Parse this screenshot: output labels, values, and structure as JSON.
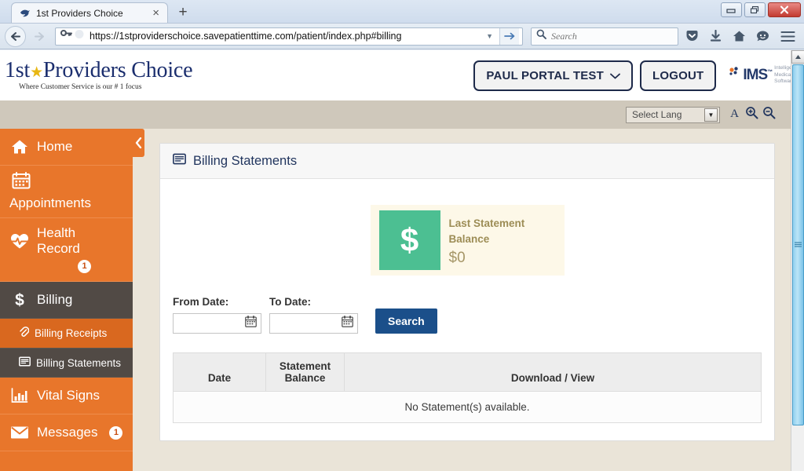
{
  "browser": {
    "tab": {
      "title": "1st Providers Choice",
      "favicon_icon": "bird-favicon",
      "close_icon": "close-icon"
    },
    "new_tab_label": "+",
    "window_controls": {
      "minimize_icon": "minimize-icon",
      "restore_icon": "restore-icon",
      "close_icon": "window-close-icon"
    },
    "nav": {
      "back_icon": "back-arrow-icon",
      "forward_icon": "forward-arrow-icon",
      "url": "https://1stproviderschoice.savepatienttime.com/patient/index.php#billing",
      "identity_icon": "key-icon",
      "reader_icon": "reader-mode-icon",
      "dropdown_icon": "chevron-down-icon",
      "go_icon": "go-arrow-icon",
      "search_placeholder": "Search",
      "search_icon": "search-icon",
      "pocket_icon": "pocket-icon",
      "downloads_icon": "downloads-icon",
      "home_icon": "home-icon",
      "sync_icon": "chat-icon",
      "menu_icon": "hamburger-menu-icon"
    }
  },
  "site": {
    "logo": {
      "prefix": "1st",
      "star": "★",
      "main": "Providers Choice",
      "tagline": "Where Customer Service is our # 1 focus"
    },
    "user_button": {
      "label": "PAUL PORTAL TEST",
      "caret_icon": "chevron-down-icon"
    },
    "logout_button": "LOGOUT",
    "ims": {
      "mark": "IMS",
      "tm": "™",
      "tagline_line1": "Intelligent",
      "tagline_line2": "Medical",
      "tagline_line3": "Software",
      "dots_icon": "ims-dots-icon"
    },
    "lang_bar": {
      "select_value": "Select Lang",
      "select_arrow_icon": "dropdown-arrow-icon",
      "font_icon": "font-size-icon",
      "zoom_in_icon": "zoom-in-icon",
      "zoom_out_icon": "zoom-out-icon"
    }
  },
  "sidebar": {
    "collapse_icon": "chevron-left-icon",
    "items": [
      {
        "label": "Home",
        "icon": "home-icon",
        "badge": null,
        "state": "normal"
      },
      {
        "label": "Appointments",
        "icon": "calendar-icon",
        "badge": null,
        "state": "normal"
      },
      {
        "label": "Health Record",
        "icon": "heart-pulse-icon",
        "badge": "1",
        "state": "normal"
      },
      {
        "label": "Billing",
        "icon": "dollar-icon",
        "badge": null,
        "state": "active"
      },
      {
        "label": "Vital Signs",
        "icon": "bar-chart-icon",
        "badge": null,
        "state": "normal"
      },
      {
        "label": "Messages",
        "icon": "envelope-icon",
        "badge": "1",
        "state": "normal"
      }
    ],
    "subitems": [
      {
        "label": "Billing Receipts",
        "icon": "paperclip-icon",
        "state": "hover"
      },
      {
        "label": "Billing Statements",
        "icon": "statement-icon",
        "state": "active"
      }
    ]
  },
  "main": {
    "panel_title": "Billing Statements",
    "panel_icon": "statement-icon",
    "balance_card": {
      "icon_glyph": "$",
      "label": "Last Statement Balance",
      "value": "$0"
    },
    "filters": {
      "from_label": "From Date:",
      "to_label": "To Date:",
      "from_value": "",
      "to_value": "",
      "calendar_icon": "calendar-icon",
      "search_button": "Search"
    },
    "table": {
      "columns": [
        "Date",
        "Statement Balance",
        "Download / View"
      ],
      "empty_message": "No Statement(s) available.",
      "rows": []
    }
  },
  "scrollbar": {
    "up_arrow_icon": "scroll-up-arrow-icon",
    "grip_icon": "scroll-grip-icon"
  },
  "colors": {
    "sidebar_orange": "#e8762b",
    "sidebar_active": "#514a45",
    "balance_green": "#4cbf92",
    "balance_card_bg": "#fdf8e8",
    "title_navy": "#21355e",
    "search_button": "#1b4f8a",
    "page_bg": "#eae4d8",
    "lang_bar": "#cfc8bb"
  }
}
